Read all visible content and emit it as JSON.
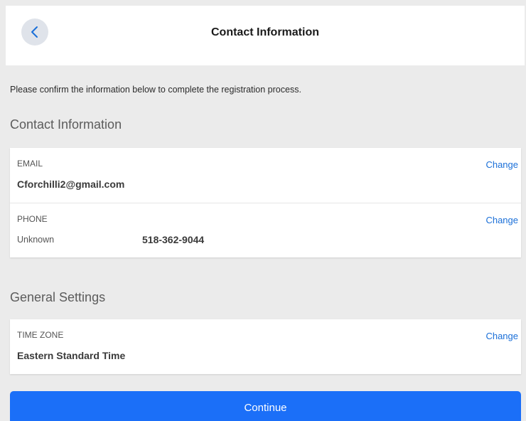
{
  "header": {
    "title": "Contact Information",
    "back_icon": "chevron-left-icon"
  },
  "intro_text": "Please confirm the information below to complete the registration process.",
  "contact_section": {
    "title": "Contact Information",
    "email": {
      "label": "EMAIL",
      "value": "Cforchilli2@gmail.com",
      "change_label": "Change"
    },
    "phone": {
      "label": "PHONE",
      "type": "Unknown",
      "value": "518-362-9044",
      "change_label": "Change"
    }
  },
  "general_section": {
    "title": "General Settings",
    "time_zone": {
      "label": "TIME ZONE",
      "value": "Eastern Standard Time",
      "change_label": "Change"
    }
  },
  "continue_label": "Continue",
  "colors": {
    "accent": "#1b6ff8",
    "link": "#1a6fd8",
    "background": "#ebebeb"
  }
}
